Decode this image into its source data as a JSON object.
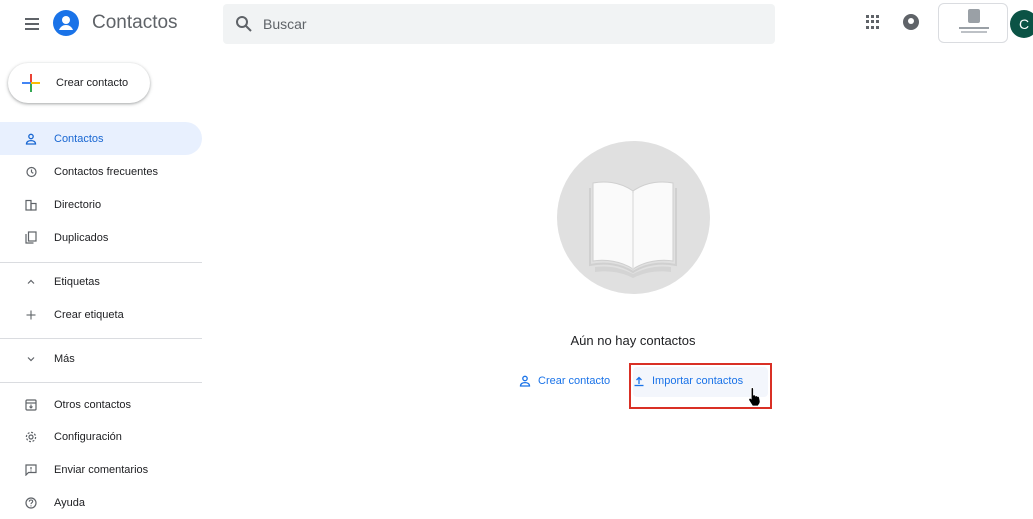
{
  "header": {
    "title": "Contactos",
    "search_placeholder": "Buscar",
    "avatar_letter": "C",
    "icons": [
      "menu-icon",
      "contacts-logo-icon",
      "search-icon",
      "apps-icon",
      "notifications-icon",
      "organization-logo",
      "avatar"
    ]
  },
  "sidebar": {
    "create_label": "Crear contacto",
    "items": [
      {
        "label": "Contactos",
        "icon": "person-icon",
        "active": true
      },
      {
        "label": "Contactos frecuentes",
        "icon": "history-icon"
      },
      {
        "label": "Directorio",
        "icon": "domain-icon"
      },
      {
        "label": "Duplicados",
        "icon": "copy-icon"
      }
    ],
    "labels_section": {
      "label": "Etiquetas",
      "icon": "chevron-up-icon"
    },
    "create_label_item": {
      "label": "Crear etiqueta",
      "icon": "plus-icon"
    },
    "more": {
      "label": "Más",
      "icon": "chevron-down-icon"
    },
    "bottom_items": [
      {
        "label": "Otros contactos",
        "icon": "archive-icon"
      },
      {
        "label": "Configuración",
        "icon": "gear-icon"
      },
      {
        "label": "Enviar comentarios",
        "icon": "feedback-icon"
      },
      {
        "label": "Ayuda",
        "icon": "help-icon"
      }
    ]
  },
  "main": {
    "empty_message": "Aún no hay contactos",
    "create_link": "Crear contacto",
    "import_link": "Importar contactos"
  },
  "colors": {
    "accent": "#1a73e8",
    "active_bg": "#e8f0fe",
    "highlight": "#d93025",
    "avatar_bg": "#0b5345"
  }
}
